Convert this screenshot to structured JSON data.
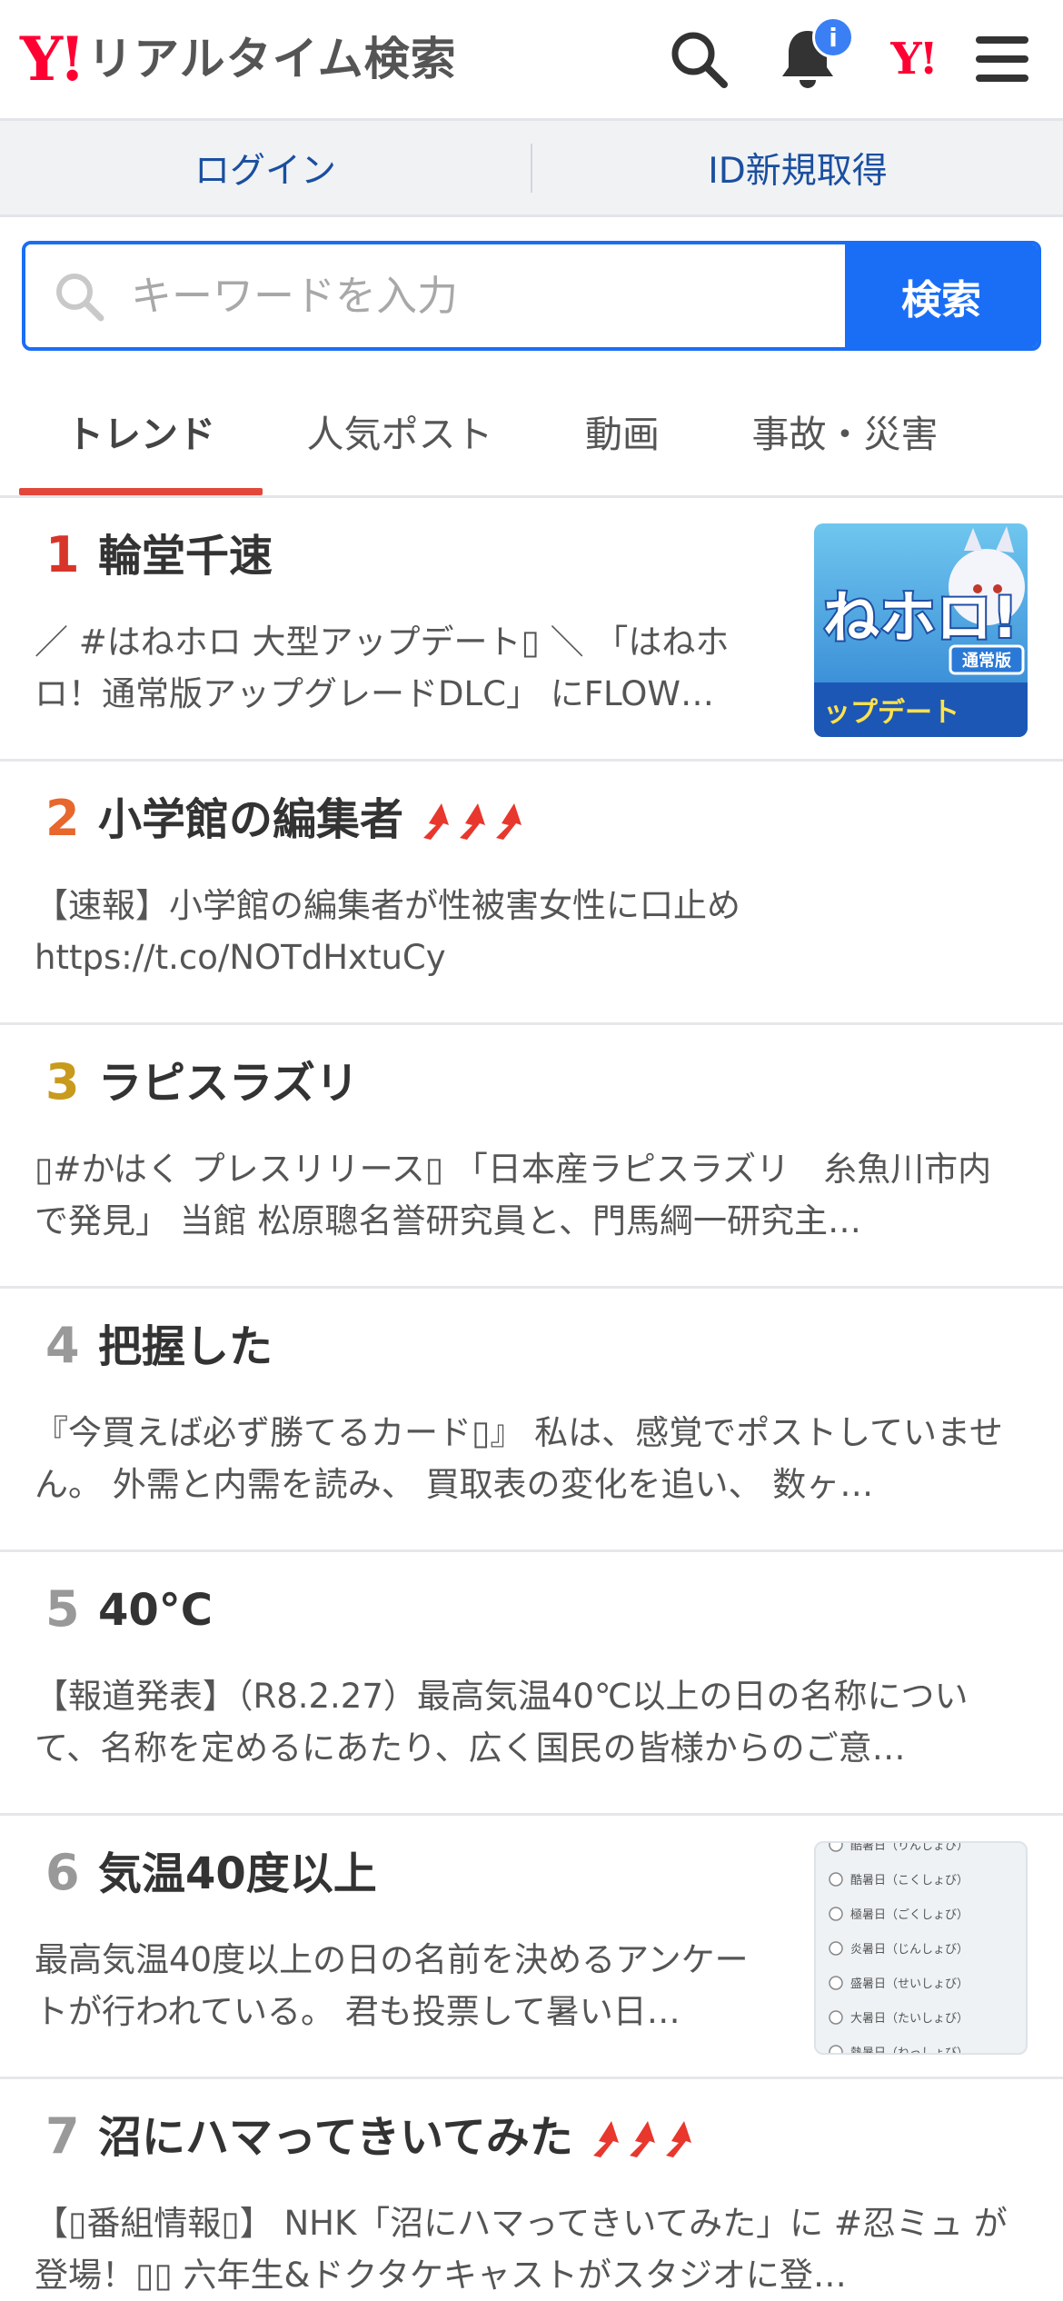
{
  "header": {
    "logo_mark": "Y!",
    "logo_title": "リアルタイム検索",
    "notification_badge": "i",
    "yjapan_mark": "Y!"
  },
  "account": {
    "login_label": "ログイン",
    "register_label": "ID新規取得"
  },
  "search": {
    "placeholder": "キーワードを入力",
    "button_label": "検索"
  },
  "tabs": [
    {
      "label": "トレンド"
    },
    {
      "label": "人気ポスト"
    },
    {
      "label": "動画"
    },
    {
      "label": "事故・災害"
    }
  ],
  "trends": [
    {
      "rank": "1",
      "title": "輪堂千速",
      "desc": "／ #はねホロ 大型アップデート▯ ＼ 「はねホロ！通常版アップグレードDLC」 にFLOW…",
      "rank_color": "#d8352a",
      "rising": false,
      "thumb_text": "ねホロ!"
    },
    {
      "rank": "2",
      "title": "小学館の編集者",
      "desc": "【速報】小学館の編集者が性被害女性に口止め https://t.co/NOTdHxtuCy",
      "rank_color": "#e7672c",
      "rising": true
    },
    {
      "rank": "3",
      "title": "ラピスラズリ",
      "desc": "▯#かはく プレスリリース▯ 「日本産ラピスラズリ　糸魚川市内で発見」 当館 松原聰名誉研究員と、門馬綱一研究主…",
      "rank_color": "#c89a1d",
      "rising": false
    },
    {
      "rank": "4",
      "title": "把握した",
      "desc": "『今買えば必ず勝てるカード▯』 私は、感覚でポストしていません。 外需と内需を読み、 買取表の変化を追い、 数ヶ…",
      "rank_color": "#999999",
      "rising": false
    },
    {
      "rank": "5",
      "title": "40°C",
      "desc": "【報道発表】（R8.2.27）最高気温40℃以上の日の名称について、名称を定めるにあたり、広く国民の皆様からのご意…",
      "rank_color": "#999999",
      "rising": false
    },
    {
      "rank": "6",
      "title": "気温40度以上",
      "desc": "最高気温40度以上の日の名前を決めるアンケートが行われている。 君も投票して暑い日…",
      "rank_color": "#999999",
      "rising": false,
      "thumb_lines": [
        "酷暑日（りんしょび）",
        "酷暑日（こくしょび）",
        "極暑日（ごくしょび）",
        "炎暑日（じんしょび）",
        "盛暑日（せいしょび）",
        "大暑日（たいしょび）",
        "熱暑日（ねっしょび）"
      ]
    },
    {
      "rank": "7",
      "title": "沼にハマってきいてみた",
      "desc": "【▯番組情報▯】 NHK「沼にハマってきいてみた」に #忍ミュ が登場！▯▯ 六年生&ドクタケキャストがスタジオに登…",
      "rank_color": "#999999",
      "rising": true
    }
  ]
}
